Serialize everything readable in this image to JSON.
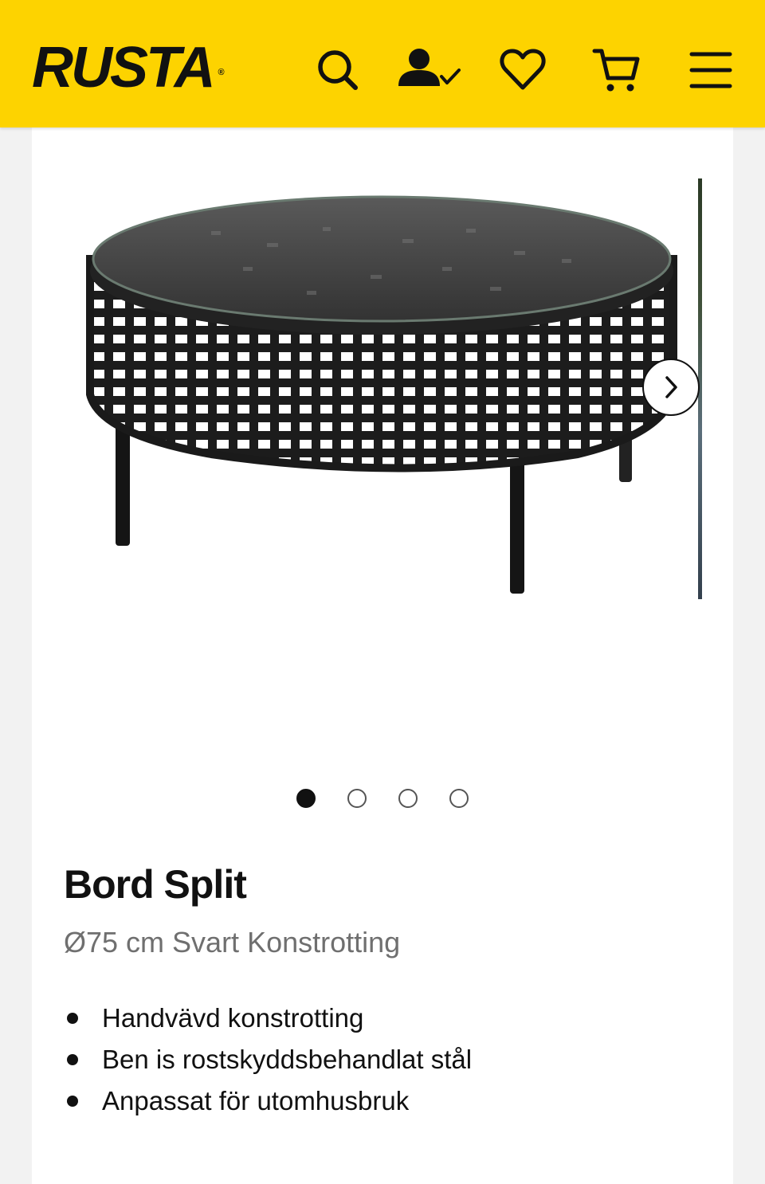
{
  "header": {
    "logo_text": "RUSTA",
    "logo_mark": "®",
    "background_color": "#fdd300",
    "icons": [
      "search-icon",
      "account-icon",
      "heart-icon",
      "cart-icon",
      "menu-icon"
    ]
  },
  "gallery": {
    "image_alt": "Bord Split",
    "slide_count": 4,
    "active_slide": 1
  },
  "product": {
    "title": "Bord Split",
    "subtitle": "Ø75 cm Svart Konstrotting",
    "features": [
      "Handvävd konstrotting",
      "Ben is rostskyddsbehandlat stål",
      "Anpassat för utomhusbruk"
    ]
  }
}
